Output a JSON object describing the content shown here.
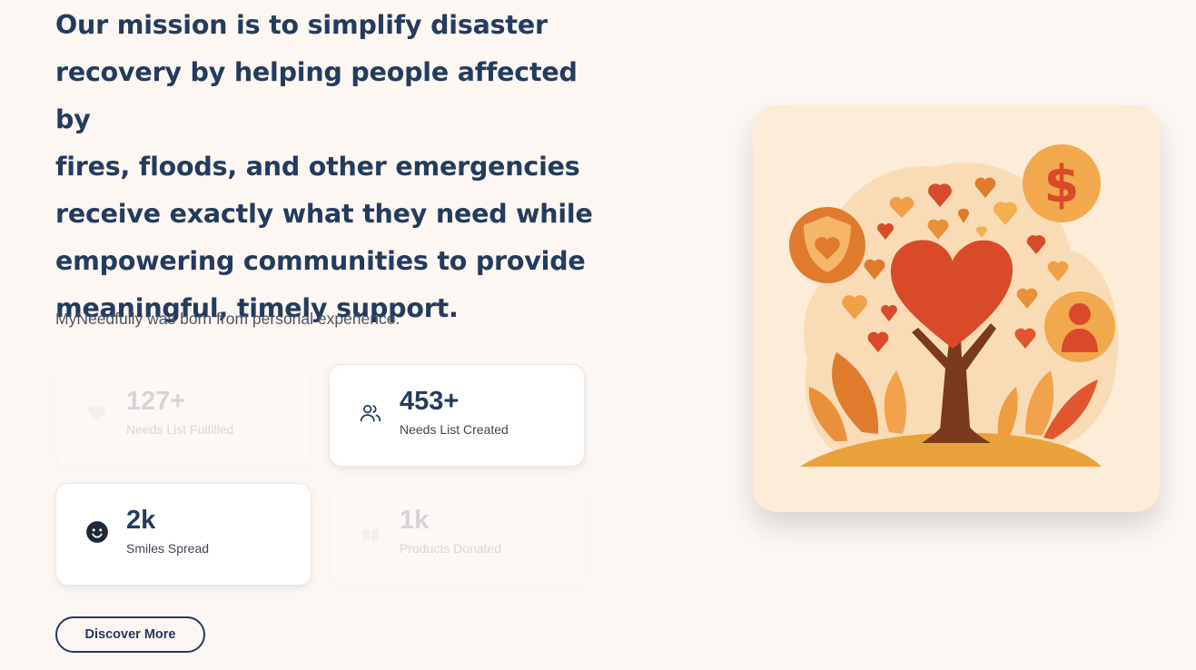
{
  "mission": {
    "lines": [
      "Our mission is to simplify disaster",
      "recovery by helping people affected by",
      "fires, floods, and other emergencies",
      "receive exactly what they need while",
      "empowering communities to provide",
      "meaningful, timely support."
    ]
  },
  "subtitle": "MyNeedfully was born from personal experience.",
  "stats": [
    {
      "value": "127+",
      "label": "Needs List Fulfilled",
      "icon": "heart-hand-icon",
      "faded": true
    },
    {
      "value": "453+",
      "label": "Needs List Created",
      "icon": "users-icon",
      "faded": false
    },
    {
      "value": "2k",
      "label": "Smiles Spread",
      "icon": "smile-icon",
      "faded": false
    },
    {
      "value": "1k",
      "label": "Products Donated",
      "icon": "gift-icon",
      "faded": true
    }
  ],
  "cta": {
    "label": "Discover More"
  },
  "colors": {
    "background": "#fdf7f3",
    "heading": "#243b5c",
    "illustration_bg": "#fcecd8",
    "heart_red": "#d94a2b",
    "orange": "#f0a046"
  }
}
